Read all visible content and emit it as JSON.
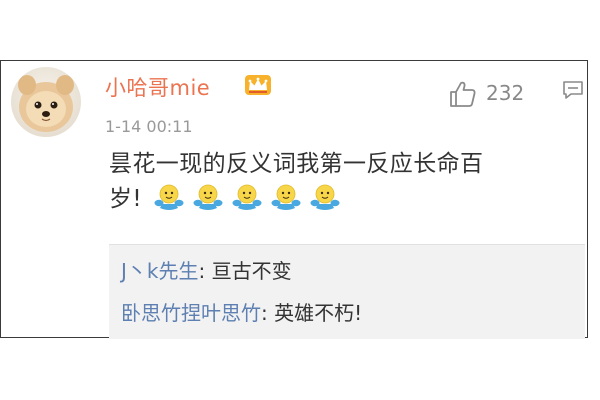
{
  "comment": {
    "username": "小哈哥mie",
    "timestamp": "1-14 00:11",
    "like_count": "232",
    "content_line1": "昙花一现的反义词我第一反应长命百",
    "content_line2": "岁!",
    "emoji_count": 5
  },
  "replies": [
    {
      "name": "J丶k先生",
      "separator": ": ",
      "text": "亘古不变"
    },
    {
      "name": "卧思竹捏叶思竹",
      "separator": ": ",
      "text": "英雄不朽!"
    }
  ],
  "icons": {
    "avatar": "pomeranian-dog-avatar",
    "badge": "crown-icon",
    "like": "thumbs-up-icon",
    "reply": "comment-icon",
    "emoji": "hand-clapping-emoji"
  },
  "colors": {
    "username": "#eb7350",
    "reply_name": "#5d7fb1",
    "timestamp": "#999999",
    "reply_background": "#f2f2f2",
    "content_text": "#333333"
  }
}
